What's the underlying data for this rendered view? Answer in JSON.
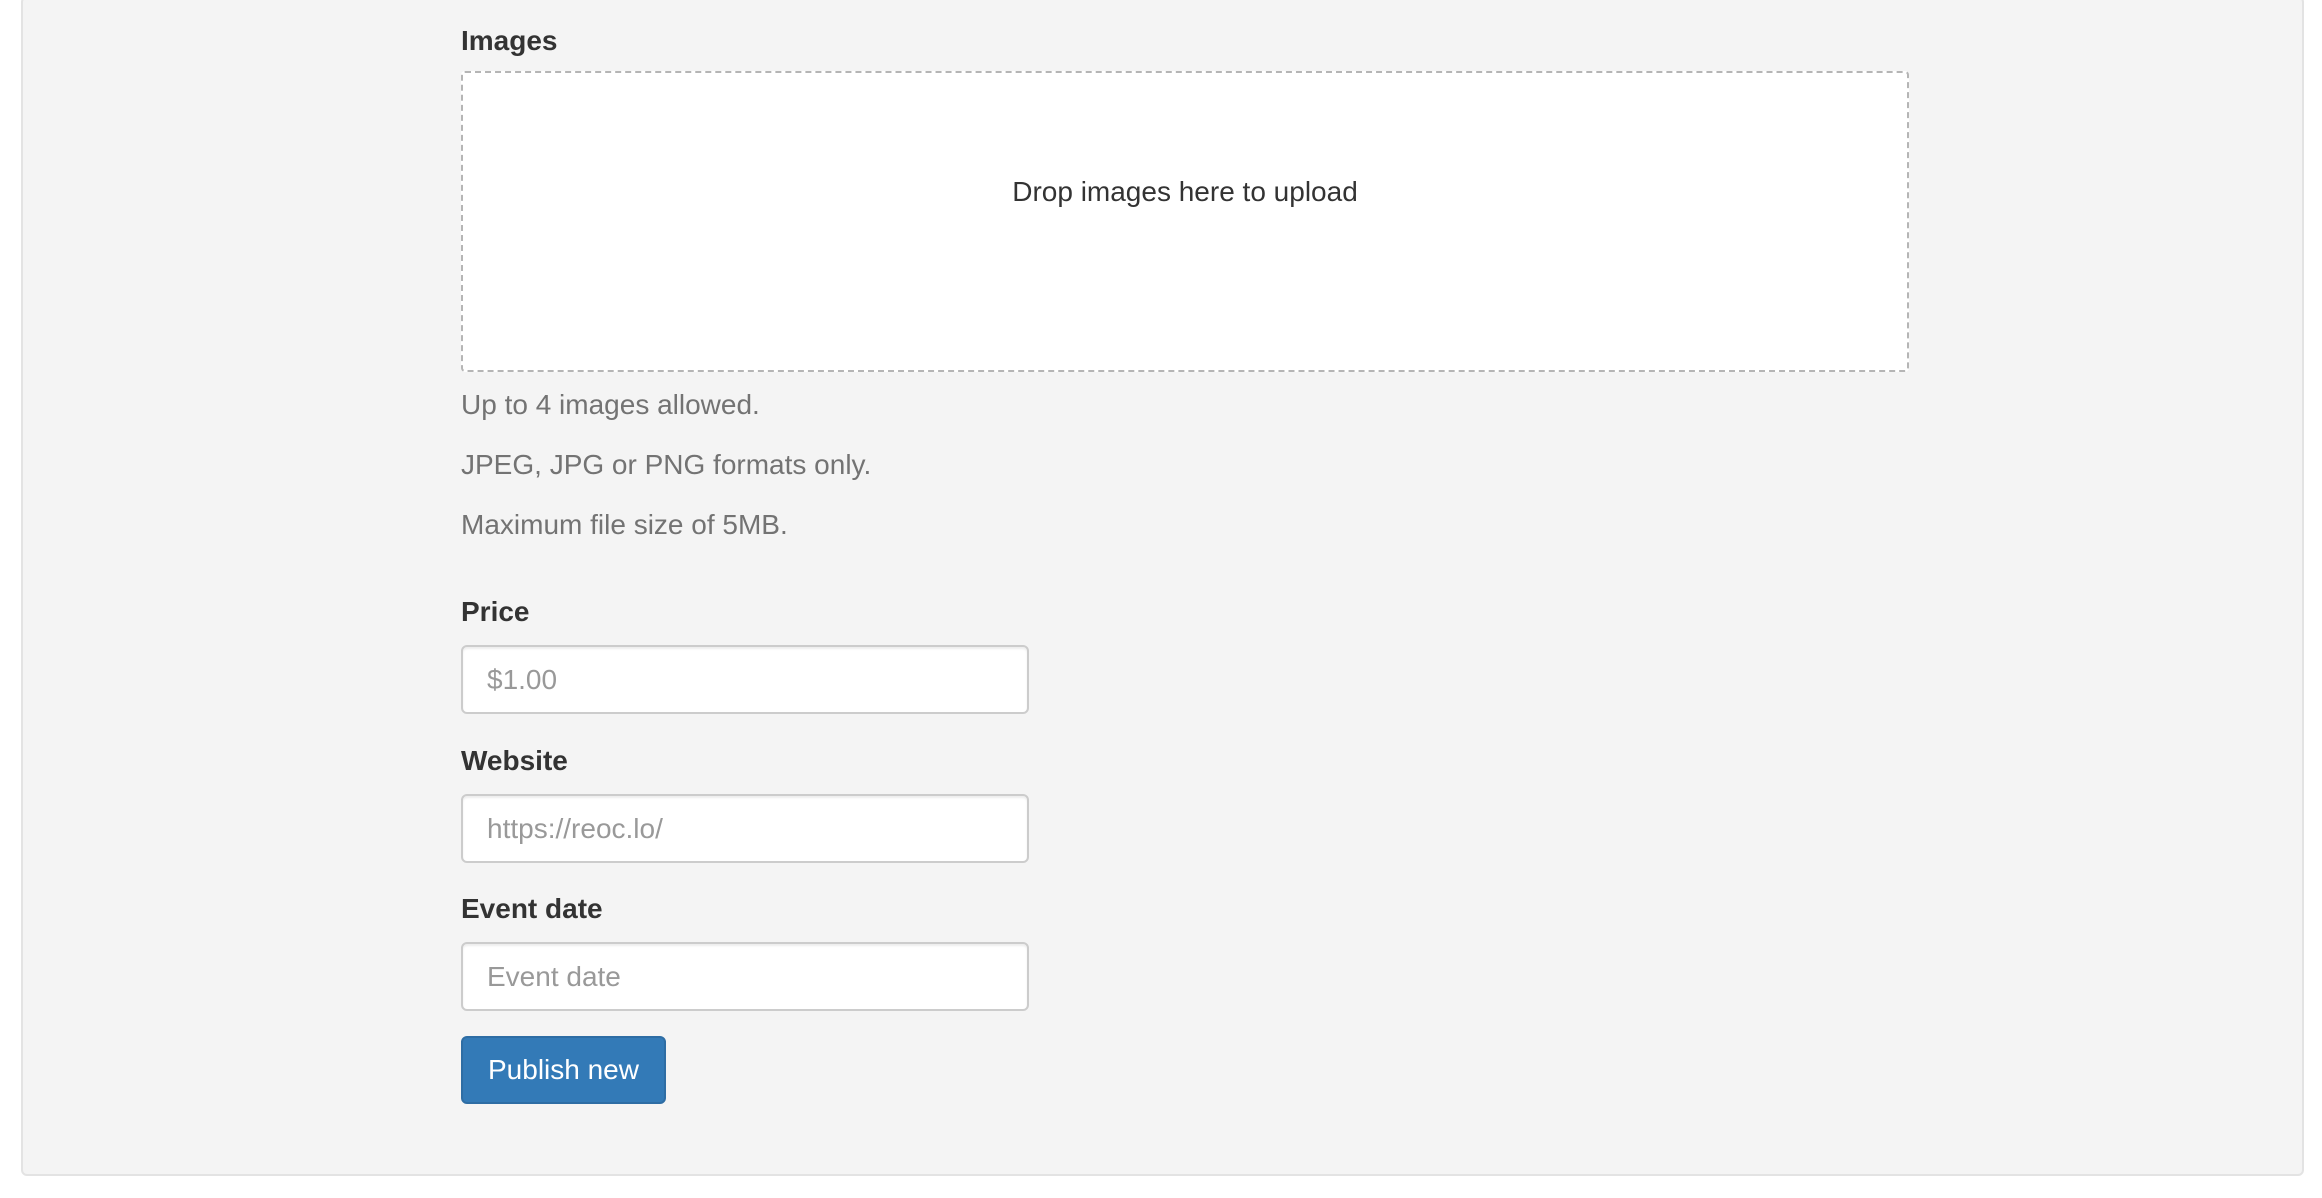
{
  "images": {
    "label": "Images",
    "dropzone_text": "Drop images here to upload",
    "help": [
      "Up to 4 images allowed.",
      "JPEG, JPG or PNG formats only.",
      "Maximum file size of 5MB."
    ]
  },
  "price": {
    "label": "Price",
    "placeholder": "$1.00",
    "value": ""
  },
  "website": {
    "label": "Website",
    "placeholder": "https://reoc.lo/",
    "value": ""
  },
  "event_date": {
    "label": "Event date",
    "placeholder": "Event date",
    "value": ""
  },
  "submit": {
    "label": "Publish new"
  },
  "colors": {
    "primary_button": "#337ab7",
    "panel_background": "#f4f4f4"
  }
}
